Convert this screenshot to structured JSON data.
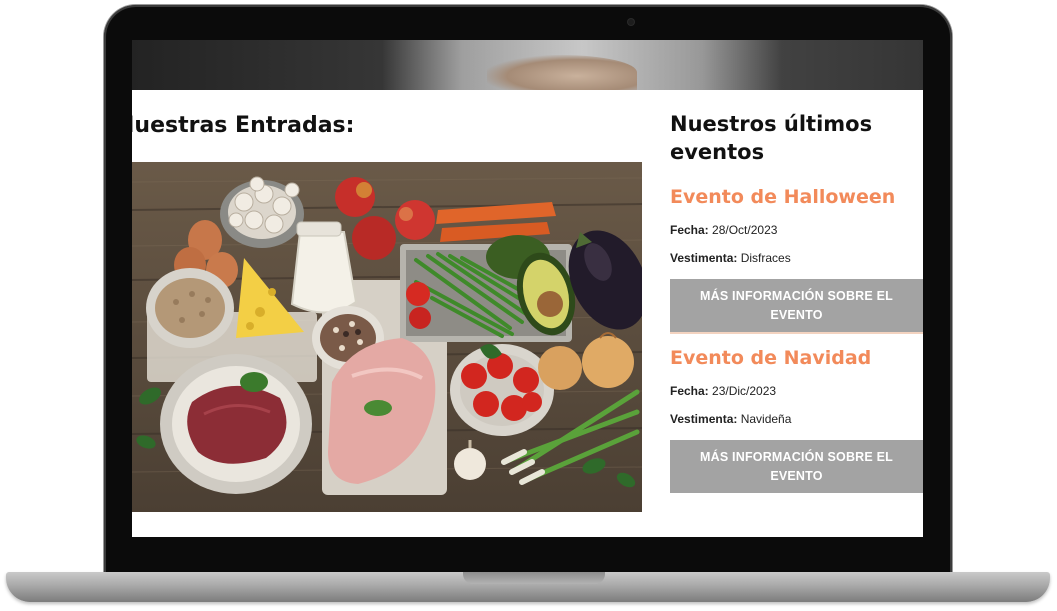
{
  "page": {
    "section_title": "Nuestras Entradas:",
    "events_title": "Nuestros últimos eventos",
    "events": [
      {
        "title": "Evento de Halloween",
        "date_label": "Fecha:",
        "date": "28/Oct/2023",
        "dress_label": "Vestimenta:",
        "dress": "Disfraces",
        "button_label": "MÁS INFORMACIÓN SOBRE EL EVENTO"
      },
      {
        "title": "Evento de Navidad",
        "date_label": "Fecha:",
        "date": "23/Dic/2023",
        "dress_label": "Vestimenta:",
        "dress": "Navideña",
        "button_label": "MÁS INFORMACIÓN SOBRE EL EVENTO"
      }
    ]
  },
  "colors": {
    "accent": "#f28a5a",
    "button_bg": "#a3a3a3",
    "button_text": "#ffffff",
    "heading": "#111111"
  }
}
